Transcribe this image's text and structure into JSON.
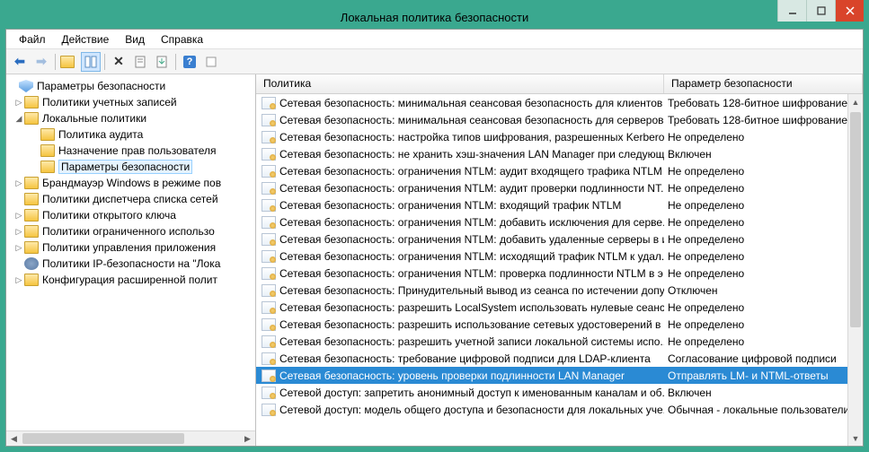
{
  "title": "Локальная политика безопасности",
  "menu": {
    "file": "Файл",
    "action": "Действие",
    "view": "Вид",
    "help": "Справка"
  },
  "tree": {
    "root": "Параметры безопасности",
    "n1": "Политики учетных записей",
    "n2": "Локальные политики",
    "n2a": "Политика аудита",
    "n2b": "Назначение прав пользователя",
    "n2c": "Параметры безопасности",
    "n3": "Брандмауэр Windows в режиме пов",
    "n4": "Политики диспетчера списка сетей",
    "n5": "Политики открытого ключа",
    "n6": "Политики ограниченного использо",
    "n7": "Политики управления приложения",
    "n8": "Политики IP-безопасности на \"Лока",
    "n9": "Конфигурация расширенной полит"
  },
  "hdr": {
    "c1": "Политика",
    "c2": "Параметр безопасности"
  },
  "rows": [
    {
      "p": "Сетевая безопасность: минимальная сеансовая безопасность для клиентов ...",
      "v": "Требовать 128-битное шифрование"
    },
    {
      "p": "Сетевая безопасность: минимальная сеансовая безопасность для серверов ...",
      "v": "Требовать 128-битное шифрование"
    },
    {
      "p": "Сетевая безопасность: настройка типов шифрования, разрешенных Kerberos",
      "v": "Не определено"
    },
    {
      "p": "Сетевая безопасность: не хранить хэш-значения LAN Manager при следующ...",
      "v": "Включен"
    },
    {
      "p": "Сетевая безопасность: ограничения NTLM: аудит входящего трафика NTLM",
      "v": "Не определено"
    },
    {
      "p": "Сетевая безопасность: ограничения NTLM: аудит проверки подлинности NT...",
      "v": "Не определено"
    },
    {
      "p": "Сетевая безопасность: ограничения NTLM: входящий трафик NTLM",
      "v": "Не определено"
    },
    {
      "p": "Сетевая безопасность: ограничения NTLM: добавить исключения для серве...",
      "v": "Не определено"
    },
    {
      "p": "Сетевая безопасность: ограничения NTLM: добавить удаленные серверы в и...",
      "v": "Не определено"
    },
    {
      "p": "Сетевая безопасность: ограничения NTLM: исходящий трафик NTLM к удал...",
      "v": "Не определено"
    },
    {
      "p": "Сетевая безопасность: ограничения NTLM: проверка подлинности NTLM в э...",
      "v": "Не определено"
    },
    {
      "p": "Сетевая безопасность: Принудительный вывод из сеанса по истечении допу...",
      "v": "Отключен"
    },
    {
      "p": "Сетевая безопасность: разрешить LocalSystem использовать нулевые сеансы",
      "v": "Не определено"
    },
    {
      "p": "Сетевая безопасность: разрешить использование сетевых удостоверений в з...",
      "v": "Не определено"
    },
    {
      "p": "Сетевая безопасность: разрешить учетной записи локальной системы испо...",
      "v": "Не определено"
    },
    {
      "p": "Сетевая безопасность: требование цифровой подписи для LDAP-клиента",
      "v": "Согласование цифровой подписи"
    },
    {
      "p": "Сетевая безопасность: уровень проверки подлинности LAN Manager",
      "v": "Отправлять LM- и NTML-ответы",
      "sel": true
    },
    {
      "p": "Сетевой доступ: запретить анонимный доступ к именованным каналам и об...",
      "v": "Включен"
    },
    {
      "p": "Сетевой доступ: модель общего доступа и безопасности для локальных уче...",
      "v": "Обычная - локальные пользователи..."
    }
  ]
}
